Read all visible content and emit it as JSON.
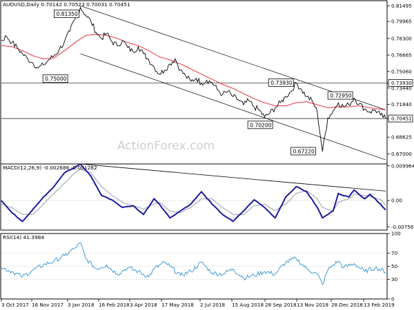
{
  "chart_data": [
    {
      "type": "line",
      "title": "AUDUSD,Daily  0.70142 0.70523 0.70031 0.70451",
      "ylim": [
        0.66,
        0.82
      ],
      "yticks": [
        "0.81495",
        "0.79965",
        "0.78300",
        "0.76665",
        "0.75060",
        "0.73440",
        "0.71840",
        "0.70451",
        "0.68625",
        "0.67000"
      ],
      "y_right_labels": [
        {
          "value": 0.81495,
          "label": "0.81495"
        },
        {
          "value": 0.79965,
          "label": "0.79965"
        },
        {
          "value": 0.783,
          "label": "0.78300"
        },
        {
          "value": 0.76665,
          "label": "0.76665"
        },
        {
          "value": 0.7506,
          "label": "0.75060"
        },
        {
          "value": 0.7344,
          "label": "0.73440"
        },
        {
          "value": 0.7393,
          "label": "0.73930"
        },
        {
          "value": 0.7184,
          "label": "0.71840"
        },
        {
          "value": 0.70451,
          "label": "0.70451"
        },
        {
          "value": 0.68625,
          "label": "0.68625"
        },
        {
          "value": 0.67,
          "label": "0.67000"
        }
      ],
      "xticks": [
        "3 Oct 2017",
        "16 Nov 2017",
        "3 Jan 2018",
        "16 Feb 2018",
        "3 Apr 2018",
        "17 May 2018",
        "2 Jul 2018",
        "15 Aug 2018",
        "28 Sep 2018",
        "13 Nov 2018",
        "28 Dec 2018",
        "13 Feb 2019"
      ],
      "series": [
        {
          "values": [
            [
              0,
              0.781
            ],
            [
              2,
              0.785
            ],
            [
              4,
              0.779
            ],
            [
              6,
              0.774
            ],
            [
              8,
              0.768
            ],
            [
              10,
              0.763
            ],
            [
              12,
              0.759
            ],
            [
              14,
              0.754
            ],
            [
              16,
              0.757
            ],
            [
              18,
              0.762
            ],
            [
              20,
              0.766
            ],
            [
              22,
              0.772
            ],
            [
              24,
              0.78
            ],
            [
              26,
              0.79
            ],
            [
              28,
              0.802
            ],
            [
              30,
              0.8135
            ],
            [
              32,
              0.806
            ],
            [
              34,
              0.8
            ],
            [
              36,
              0.789
            ],
            [
              38,
              0.783
            ],
            [
              40,
              0.788
            ],
            [
              42,
              0.78
            ],
            [
              44,
              0.776
            ],
            [
              46,
              0.781
            ],
            [
              48,
              0.774
            ],
            [
              50,
              0.77
            ],
            [
              52,
              0.775
            ],
            [
              54,
              0.768
            ],
            [
              56,
              0.762
            ],
            [
              58,
              0.755
            ],
            [
              60,
              0.748
            ],
            [
              62,
              0.752
            ],
            [
              64,
              0.758
            ],
            [
              66,
              0.763
            ],
            [
              68,
              0.752
            ],
            [
              70,
              0.746
            ],
            [
              72,
              0.741
            ],
            [
              74,
              0.744
            ],
            [
              76,
              0.739
            ],
            [
              78,
              0.742
            ],
            [
              80,
              0.74
            ],
            [
              82,
              0.733
            ],
            [
              84,
              0.728
            ],
            [
              86,
              0.731
            ],
            [
              88,
              0.726
            ],
            [
              90,
              0.723
            ],
            [
              92,
              0.718
            ],
            [
              94,
              0.722
            ],
            [
              96,
              0.716
            ],
            [
              98,
              0.7125
            ],
            [
              100,
              0.706
            ],
            [
              102,
              0.71
            ],
            [
              104,
              0.715
            ],
            [
              106,
              0.72
            ],
            [
              108,
              0.726
            ],
            [
              110,
              0.731
            ],
            [
              112,
              0.7393
            ],
            [
              114,
              0.733
            ],
            [
              116,
              0.726
            ],
            [
              118,
              0.722
            ],
            [
              120,
              0.711
            ],
            [
              122,
              0.6722
            ],
            [
              124,
              0.705
            ],
            [
              126,
              0.712
            ],
            [
              128,
              0.72
            ],
            [
              130,
              0.716
            ],
            [
              132,
              0.718
            ],
            [
              134,
              0.7245
            ],
            [
              136,
              0.719
            ],
            [
              138,
              0.714
            ],
            [
              140,
              0.711
            ],
            [
              142,
              0.713
            ],
            [
              144,
              0.708
            ],
            [
              146,
              0.7045
            ]
          ]
        },
        {
          "values": [
            [
              0,
              0.776
            ],
            [
              4,
              0.775
            ],
            [
              8,
              0.771
            ],
            [
              12,
              0.766
            ],
            [
              16,
              0.763
            ],
            [
              20,
              0.764
            ],
            [
              24,
              0.771
            ],
            [
              28,
              0.779
            ],
            [
              32,
              0.786
            ],
            [
              36,
              0.787
            ],
            [
              40,
              0.786
            ],
            [
              44,
              0.783
            ],
            [
              48,
              0.779
            ],
            [
              52,
              0.776
            ],
            [
              56,
              0.771
            ],
            [
              60,
              0.765
            ],
            [
              64,
              0.762
            ],
            [
              68,
              0.758
            ],
            [
              72,
              0.753
            ],
            [
              76,
              0.748
            ],
            [
              80,
              0.743
            ],
            [
              84,
              0.738
            ],
            [
              88,
              0.734
            ],
            [
              92,
              0.729
            ],
            [
              96,
              0.724
            ],
            [
              100,
              0.72
            ],
            [
              104,
              0.717
            ],
            [
              108,
              0.717
            ],
            [
              112,
              0.72
            ],
            [
              116,
              0.721
            ],
            [
              120,
              0.718
            ],
            [
              124,
              0.715
            ],
            [
              128,
              0.716
            ],
            [
              132,
              0.716
            ],
            [
              136,
              0.717
            ],
            [
              140,
              0.715
            ],
            [
              146,
              0.713
            ]
          ]
        }
      ],
      "annotations": [
        {
          "label": "0.81350",
          "x": 30,
          "y": 0.8135
        },
        {
          "label": "0.75000",
          "x": 10,
          "y": 0.75
        },
        {
          "label": "0.73930",
          "x": 112,
          "y": 0.7393
        },
        {
          "label": "0.72950",
          "x": 134,
          "y": 0.7295
        },
        {
          "label": "0.70200",
          "x": 102,
          "y": 0.702
        },
        {
          "label": "0.67220",
          "x": 122,
          "y": 0.6722
        }
      ],
      "horizontal_lines": [
        0.7393,
        0.70451
      ],
      "channel": {
        "upper": [
          [
            30,
            0.815
          ],
          [
            146,
            0.713
          ]
        ],
        "lower": [
          [
            30,
            0.768
          ],
          [
            146,
            0.664
          ]
        ]
      },
      "watermark": "ActionForex.com"
    },
    {
      "type": "line",
      "title": "MACD(12,26,9) -0.002686 -0.001282",
      "ylim": [
        -0.0085,
        0.0105
      ],
      "yticks": [
        "0.009964",
        "0.00",
        "-0.00756"
      ],
      "series": [
        {
          "values": [
            [
              0,
              0.0
            ],
            [
              4,
              -0.0035
            ],
            [
              8,
              -0.006
            ],
            [
              12,
              -0.0025
            ],
            [
              16,
              0.001
            ],
            [
              20,
              0.004
            ],
            [
              24,
              0.008
            ],
            [
              28,
              0.0095
            ],
            [
              30,
              0.0105
            ],
            [
              34,
              0.007
            ],
            [
              38,
              0.0015
            ],
            [
              42,
              0.0002
            ],
            [
              46,
              -0.002
            ],
            [
              50,
              -0.0015
            ],
            [
              54,
              -0.004
            ],
            [
              58,
              0.0005
            ],
            [
              60,
              -0.001
            ],
            [
              64,
              -0.005
            ],
            [
              68,
              -0.003
            ],
            [
              72,
              -0.001
            ],
            [
              76,
              0.0025
            ],
            [
              80,
              -0.001
            ],
            [
              84,
              -0.004
            ],
            [
              88,
              -0.006
            ],
            [
              92,
              -0.003
            ],
            [
              96,
              0.0002
            ],
            [
              100,
              -0.002
            ],
            [
              104,
              -0.005
            ],
            [
              108,
              0.001
            ],
            [
              112,
              0.004
            ],
            [
              116,
              0.0025
            ],
            [
              120,
              -0.002
            ],
            [
              122,
              -0.005
            ],
            [
              126,
              -0.003
            ],
            [
              128,
              0.002
            ],
            [
              132,
              0.001
            ],
            [
              134,
              0.003
            ],
            [
              138,
              0.0005
            ],
            [
              140,
              0.0018
            ],
            [
              144,
              -0.001
            ],
            [
              146,
              -0.0027
            ]
          ]
        },
        {
          "values": [
            [
              0,
              -0.001
            ],
            [
              4,
              -0.002
            ],
            [
              8,
              -0.004
            ],
            [
              12,
              -0.004
            ],
            [
              16,
              -0.001
            ],
            [
              20,
              0.002
            ],
            [
              24,
              0.005
            ],
            [
              28,
              0.008
            ],
            [
              30,
              0.009
            ],
            [
              34,
              0.008
            ],
            [
              38,
              0.004
            ],
            [
              42,
              0.0015
            ],
            [
              46,
              -0.0005
            ],
            [
              50,
              -0.0015
            ],
            [
              54,
              -0.0025
            ],
            [
              58,
              -0.001
            ],
            [
              60,
              -0.0005
            ],
            [
              64,
              -0.003
            ],
            [
              68,
              -0.0035
            ],
            [
              72,
              -0.002
            ],
            [
              76,
              0.0005
            ],
            [
              80,
              0.0005
            ],
            [
              84,
              -0.002
            ],
            [
              88,
              -0.004
            ],
            [
              92,
              -0.004
            ],
            [
              96,
              -0.0015
            ],
            [
              100,
              -0.001
            ],
            [
              104,
              -0.003
            ],
            [
              108,
              -0.001
            ],
            [
              112,
              0.002
            ],
            [
              116,
              0.0028
            ],
            [
              120,
              0.0005
            ],
            [
              122,
              -0.002
            ],
            [
              126,
              -0.003
            ],
            [
              128,
              -0.0005
            ],
            [
              132,
              0.0005
            ],
            [
              134,
              0.0018
            ],
            [
              138,
              0.0015
            ],
            [
              140,
              0.0012
            ],
            [
              144,
              0.0003
            ],
            [
              146,
              -0.0013
            ]
          ]
        }
      ],
      "trendline": [
        [
          30,
          0.0105
        ],
        [
          146,
          0.0027
        ]
      ]
    },
    {
      "type": "line",
      "title": "RSI(14) 41.3984",
      "ylim": [
        0,
        100
      ],
      "yticks": [
        "100",
        "70",
        "50",
        "30",
        "0"
      ],
      "series": [
        {
          "values": [
            [
              0,
              48
            ],
            [
              4,
              42
            ],
            [
              8,
              34
            ],
            [
              12,
              44
            ],
            [
              16,
              52
            ],
            [
              20,
              58
            ],
            [
              24,
              66
            ],
            [
              28,
              78
            ],
            [
              30,
              86
            ],
            [
              32,
              62
            ],
            [
              36,
              46
            ],
            [
              40,
              52
            ],
            [
              44,
              38
            ],
            [
              48,
              48
            ],
            [
              52,
              42
            ],
            [
              56,
              34
            ],
            [
              58,
              46
            ],
            [
              62,
              56
            ],
            [
              64,
              50
            ],
            [
              68,
              36
            ],
            [
              72,
              42
            ],
            [
              76,
              56
            ],
            [
              80,
              40
            ],
            [
              84,
              38
            ],
            [
              88,
              46
            ],
            [
              92,
              32
            ],
            [
              96,
              36
            ],
            [
              100,
              42
            ],
            [
              104,
              38
            ],
            [
              108,
              56
            ],
            [
              112,
              62
            ],
            [
              116,
              46
            ],
            [
              120,
              38
            ],
            [
              122,
              22
            ],
            [
              124,
              44
            ],
            [
              126,
              52
            ],
            [
              128,
              58
            ],
            [
              130,
              48
            ],
            [
              134,
              54
            ],
            [
              138,
              42
            ],
            [
              142,
              48
            ],
            [
              146,
              41.4
            ]
          ]
        }
      ]
    }
  ],
  "colors": {
    "price": "#000000",
    "ma": "#e8303a",
    "macd": "#1a1a9c",
    "signal": "#9a9ab0",
    "rsi": "#3090d0",
    "channel": "#000000",
    "level_line": "#333333",
    "border": "#000000"
  }
}
